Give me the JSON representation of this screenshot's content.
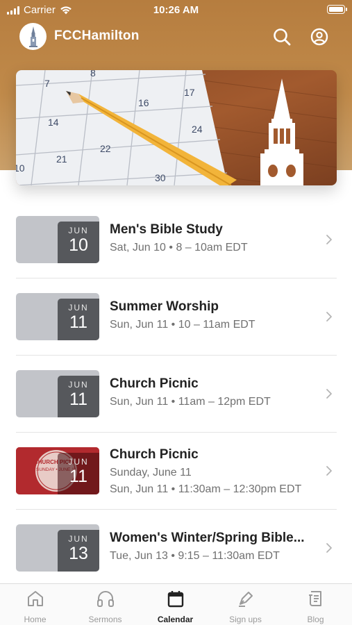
{
  "status_bar": {
    "carrier": "Carrier",
    "time": "10:26 AM"
  },
  "header": {
    "title": "FCCHamilton"
  },
  "banner": {
    "calendar_numbers": [
      "8",
      "7",
      "17",
      "16",
      "14",
      "24",
      "22",
      "21",
      "30",
      "10"
    ]
  },
  "events": [
    {
      "month": "JUN",
      "day": "10",
      "title": "Men's Bible Study",
      "lines": [
        "Sat, Jun 10 • 8 – 10am EDT"
      ],
      "image": false
    },
    {
      "month": "JUN",
      "day": "11",
      "title": "Summer Worship",
      "lines": [
        "Sun, Jun 11 • 10 – 11am EDT"
      ],
      "image": false
    },
    {
      "month": "JUN",
      "day": "11",
      "title": "Church Picnic",
      "lines": [
        "Sun, Jun 11 • 11am – 12pm EDT"
      ],
      "image": false
    },
    {
      "month": "JUN",
      "day": "11",
      "title": "Church Picnic",
      "lines": [
        "Sunday, June 11",
        "Sun, Jun 11 • 11:30am – 12:30pm EDT"
      ],
      "image": true,
      "image_text": [
        "CHURCH PICNIC",
        "SUNDAY • JUNE 11"
      ]
    },
    {
      "month": "JUN",
      "day": "13",
      "title": "Women's Winter/Spring Bible...",
      "lines": [
        "Tue, Jun 13 • 9:15 – 11:30am EDT"
      ],
      "image": false
    }
  ],
  "tabs": [
    {
      "label": "Home",
      "icon": "home-icon",
      "active": false
    },
    {
      "label": "Sermons",
      "icon": "headphones-icon",
      "active": false
    },
    {
      "label": "Calendar",
      "icon": "calendar-icon",
      "active": true
    },
    {
      "label": "Sign ups",
      "icon": "pen-icon",
      "active": false
    },
    {
      "label": "Blog",
      "icon": "blog-icon",
      "active": false
    }
  ],
  "colors": {
    "header_brown": "#b67d3f",
    "date_box": "#56585c",
    "thumb_gray": "#c2c4c9",
    "picnic_red": "#b22a2e",
    "pencil_yellow": "#f2b43a"
  }
}
